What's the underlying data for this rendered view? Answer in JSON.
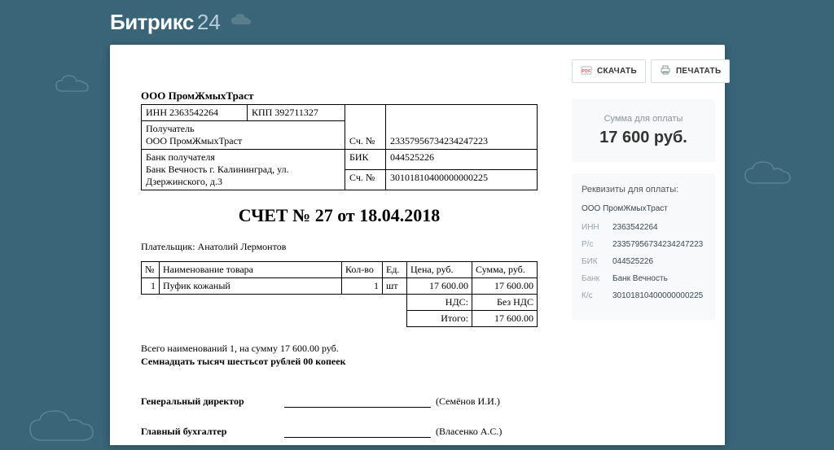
{
  "brand": {
    "name": "Битрикс",
    "suffix": "24"
  },
  "actions": {
    "download": "СКАЧАТЬ",
    "print": "ПЕЧАТАТЬ"
  },
  "payment_box": {
    "label": "Сумма для оплаты",
    "amount": "17 600 руб."
  },
  "requisites_panel": {
    "title": "Реквизиты для оплаты:",
    "org": "ООО ПромЖмыхТраст",
    "rows": {
      "inn_k": "ИНН",
      "inn_v": "2363542264",
      "rs_k": "Р/с",
      "rs_v": "23357956734234247223",
      "bik_k": "БИК",
      "bik_v": "044525226",
      "bank_k": "Банк",
      "bank_v": "Банк Вечность",
      "ks_k": "К/с",
      "ks_v": "30101810400000000225"
    }
  },
  "invoice": {
    "company": "ООО ПромЖмыхТраст",
    "inn_label": "ИНН 2363542264",
    "kpp_label": "КПП 392711327",
    "recipient_label": "Получатель",
    "recipient_name": "ООО ПромЖмыхТраст",
    "acc_label": "Сч. №",
    "acc_value": "23357956734234247223",
    "bank_label": "Банк получателя",
    "bank_name": "Банк Вечность г. Калининград, ул. Дзержинского, д.3",
    "bik_label": "БИК",
    "bik_value": "044525226",
    "corr_label": "Сч. №",
    "corr_value": "30101810400000000225",
    "title": "СЧЕТ № 27 от 18.04.2018",
    "payer_label": "Плательщик: Анатолий Лермонтов",
    "cols": {
      "n": "№",
      "name": "Наименование товара",
      "qty": "Кол-во",
      "unit": "Ед.",
      "price": "Цена, руб.",
      "sum": "Сумма, руб."
    },
    "row1": {
      "n": "1",
      "name": "Пуфик кожаный",
      "qty": "1",
      "unit": "шт",
      "price": "17 600.00",
      "sum": "17 600.00"
    },
    "vat_label": "НДС:",
    "vat_value": "Без НДС",
    "total_label": "Итого:",
    "total_value": "17 600.00",
    "summary_line": "Всего наименований 1, на сумму 17 600.00 руб.",
    "summary_words": "Семнадцать тысяч шестьсот рублей 00 копеек",
    "sig1_role": "Генеральный директор",
    "sig1_name": "(Семёнов И.И.)",
    "sig2_role": "Главный бухгалтер",
    "sig2_name": "(Власенко А.С.)"
  }
}
